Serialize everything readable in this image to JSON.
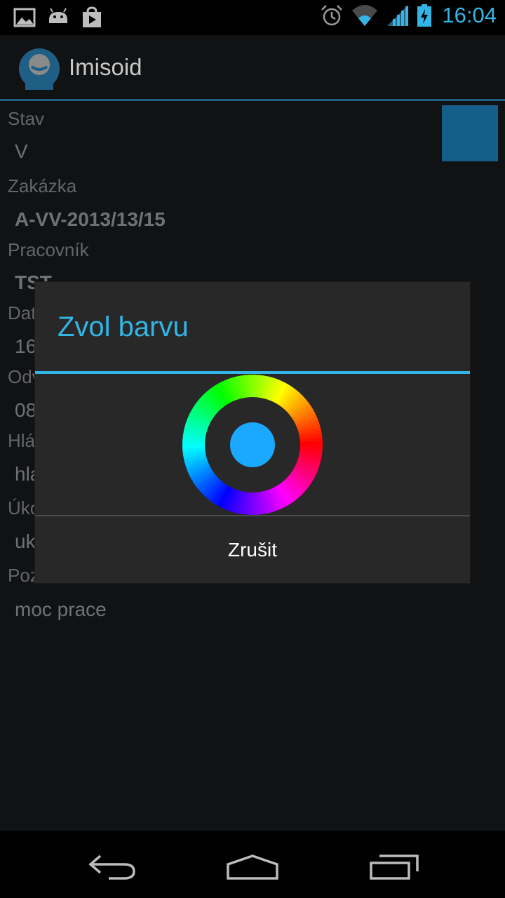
{
  "status_bar": {
    "time": "16:04",
    "icons": [
      "gallery-icon",
      "android-icon",
      "play-store-icon",
      "alarm-icon",
      "wifi-icon",
      "signal-icon",
      "battery-charging-icon"
    ],
    "accent": "#33b5e5"
  },
  "app": {
    "title": "Imisoid",
    "fields": [
      {
        "label": "Stav",
        "value": "V"
      },
      {
        "label": "Zakázka",
        "value": "A-VV-2013/13/15"
      },
      {
        "label": "Pracovník",
        "value": "TST"
      },
      {
        "label": "Dat",
        "value": "16"
      },
      {
        "label": "Odv",
        "value": "08"
      },
      {
        "label": "Hlá",
        "value": "hla"
      },
      {
        "label": "Úko",
        "value": "uk"
      },
      {
        "label": "Poz",
        "value": "moc prace"
      }
    ],
    "color_swatch": "#1aa9ff"
  },
  "dialog": {
    "title": "Zvol barvu",
    "selected_color": "#1aa9ff",
    "cancel_label": "Zrušit"
  },
  "nav_bar": {
    "icons": [
      "back-icon",
      "home-icon",
      "recent-apps-icon"
    ]
  }
}
